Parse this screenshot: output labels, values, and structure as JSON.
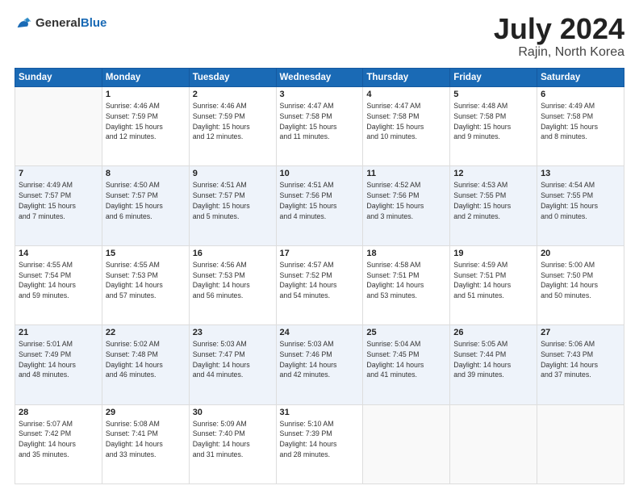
{
  "logo": {
    "text_general": "General",
    "text_blue": "Blue"
  },
  "title": {
    "month_year": "July 2024",
    "location": "Rajin, North Korea"
  },
  "weekdays": [
    "Sunday",
    "Monday",
    "Tuesday",
    "Wednesday",
    "Thursday",
    "Friday",
    "Saturday"
  ],
  "weeks": [
    [
      {
        "day": "",
        "info": ""
      },
      {
        "day": "1",
        "info": "Sunrise: 4:46 AM\nSunset: 7:59 PM\nDaylight: 15 hours\nand 12 minutes."
      },
      {
        "day": "2",
        "info": "Sunrise: 4:46 AM\nSunset: 7:59 PM\nDaylight: 15 hours\nand 12 minutes."
      },
      {
        "day": "3",
        "info": "Sunrise: 4:47 AM\nSunset: 7:58 PM\nDaylight: 15 hours\nand 11 minutes."
      },
      {
        "day": "4",
        "info": "Sunrise: 4:47 AM\nSunset: 7:58 PM\nDaylight: 15 hours\nand 10 minutes."
      },
      {
        "day": "5",
        "info": "Sunrise: 4:48 AM\nSunset: 7:58 PM\nDaylight: 15 hours\nand 9 minutes."
      },
      {
        "day": "6",
        "info": "Sunrise: 4:49 AM\nSunset: 7:58 PM\nDaylight: 15 hours\nand 8 minutes."
      }
    ],
    [
      {
        "day": "7",
        "info": "Sunrise: 4:49 AM\nSunset: 7:57 PM\nDaylight: 15 hours\nand 7 minutes."
      },
      {
        "day": "8",
        "info": "Sunrise: 4:50 AM\nSunset: 7:57 PM\nDaylight: 15 hours\nand 6 minutes."
      },
      {
        "day": "9",
        "info": "Sunrise: 4:51 AM\nSunset: 7:57 PM\nDaylight: 15 hours\nand 5 minutes."
      },
      {
        "day": "10",
        "info": "Sunrise: 4:51 AM\nSunset: 7:56 PM\nDaylight: 15 hours\nand 4 minutes."
      },
      {
        "day": "11",
        "info": "Sunrise: 4:52 AM\nSunset: 7:56 PM\nDaylight: 15 hours\nand 3 minutes."
      },
      {
        "day": "12",
        "info": "Sunrise: 4:53 AM\nSunset: 7:55 PM\nDaylight: 15 hours\nand 2 minutes."
      },
      {
        "day": "13",
        "info": "Sunrise: 4:54 AM\nSunset: 7:55 PM\nDaylight: 15 hours\nand 0 minutes."
      }
    ],
    [
      {
        "day": "14",
        "info": "Sunrise: 4:55 AM\nSunset: 7:54 PM\nDaylight: 14 hours\nand 59 minutes."
      },
      {
        "day": "15",
        "info": "Sunrise: 4:55 AM\nSunset: 7:53 PM\nDaylight: 14 hours\nand 57 minutes."
      },
      {
        "day": "16",
        "info": "Sunrise: 4:56 AM\nSunset: 7:53 PM\nDaylight: 14 hours\nand 56 minutes."
      },
      {
        "day": "17",
        "info": "Sunrise: 4:57 AM\nSunset: 7:52 PM\nDaylight: 14 hours\nand 54 minutes."
      },
      {
        "day": "18",
        "info": "Sunrise: 4:58 AM\nSunset: 7:51 PM\nDaylight: 14 hours\nand 53 minutes."
      },
      {
        "day": "19",
        "info": "Sunrise: 4:59 AM\nSunset: 7:51 PM\nDaylight: 14 hours\nand 51 minutes."
      },
      {
        "day": "20",
        "info": "Sunrise: 5:00 AM\nSunset: 7:50 PM\nDaylight: 14 hours\nand 50 minutes."
      }
    ],
    [
      {
        "day": "21",
        "info": "Sunrise: 5:01 AM\nSunset: 7:49 PM\nDaylight: 14 hours\nand 48 minutes."
      },
      {
        "day": "22",
        "info": "Sunrise: 5:02 AM\nSunset: 7:48 PM\nDaylight: 14 hours\nand 46 minutes."
      },
      {
        "day": "23",
        "info": "Sunrise: 5:03 AM\nSunset: 7:47 PM\nDaylight: 14 hours\nand 44 minutes."
      },
      {
        "day": "24",
        "info": "Sunrise: 5:03 AM\nSunset: 7:46 PM\nDaylight: 14 hours\nand 42 minutes."
      },
      {
        "day": "25",
        "info": "Sunrise: 5:04 AM\nSunset: 7:45 PM\nDaylight: 14 hours\nand 41 minutes."
      },
      {
        "day": "26",
        "info": "Sunrise: 5:05 AM\nSunset: 7:44 PM\nDaylight: 14 hours\nand 39 minutes."
      },
      {
        "day": "27",
        "info": "Sunrise: 5:06 AM\nSunset: 7:43 PM\nDaylight: 14 hours\nand 37 minutes."
      }
    ],
    [
      {
        "day": "28",
        "info": "Sunrise: 5:07 AM\nSunset: 7:42 PM\nDaylight: 14 hours\nand 35 minutes."
      },
      {
        "day": "29",
        "info": "Sunrise: 5:08 AM\nSunset: 7:41 PM\nDaylight: 14 hours\nand 33 minutes."
      },
      {
        "day": "30",
        "info": "Sunrise: 5:09 AM\nSunset: 7:40 PM\nDaylight: 14 hours\nand 31 minutes."
      },
      {
        "day": "31",
        "info": "Sunrise: 5:10 AM\nSunset: 7:39 PM\nDaylight: 14 hours\nand 28 minutes."
      },
      {
        "day": "",
        "info": ""
      },
      {
        "day": "",
        "info": ""
      },
      {
        "day": "",
        "info": ""
      }
    ]
  ]
}
